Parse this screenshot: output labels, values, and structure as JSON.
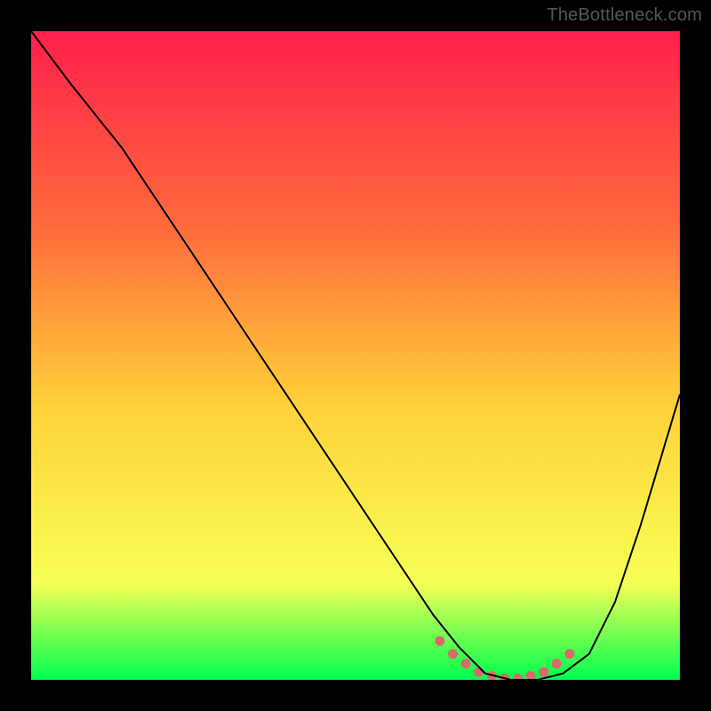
{
  "watermark": "TheBottleneck.com",
  "chart_data": {
    "type": "line",
    "title": "",
    "xlabel": "",
    "ylabel": "",
    "xlim": [
      0,
      100
    ],
    "ylim": [
      0,
      100
    ],
    "gradient": {
      "top": "#ff1f4b",
      "mid_upper": "#ff6a3c",
      "mid": "#ffd23a",
      "mid_lower": "#f7ff55",
      "bottom": "#00ff4e"
    },
    "curve": {
      "name": "bottleneck-curve",
      "color": "#000000",
      "x": [
        0,
        6,
        14,
        22,
        30,
        38,
        46,
        54,
        62,
        66,
        70,
        74,
        78,
        82,
        86,
        90,
        94,
        100
      ],
      "y": [
        100,
        92,
        82,
        70,
        58,
        46,
        34,
        22,
        10,
        5,
        1,
        0,
        0,
        1,
        4,
        12,
        24,
        44
      ]
    },
    "trough_markers": {
      "name": "trough-dots",
      "color": "#d76a6a",
      "x": [
        63,
        65,
        67,
        69,
        71,
        73,
        75,
        77,
        79,
        81,
        83
      ],
      "y": [
        6,
        4,
        2.5,
        1.2,
        0.6,
        0.2,
        0.2,
        0.6,
        1.2,
        2.5,
        4
      ]
    }
  }
}
